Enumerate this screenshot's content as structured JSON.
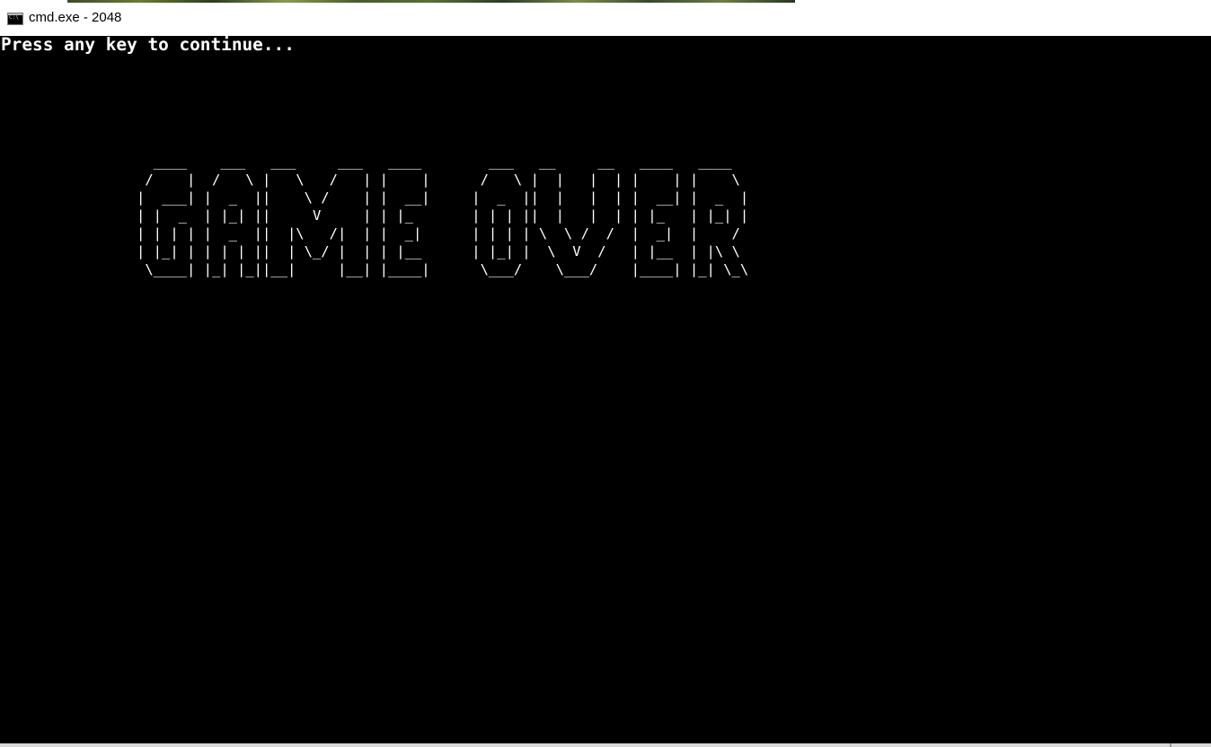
{
  "window": {
    "title": "cmd.exe - 2048",
    "icon": "console-app-icon"
  },
  "console": {
    "prompt": "Press any key to continue...",
    "game_over_art": "  ____    ___   ___     ___   ____        ___   __     __   ____   ____\n /    |  /   \\ |   \\   /   | |    |      /   \\ |  |   |  | |    | |    \\\n|  ___| |  _  ||    \\ /    | |  __|     |  _  ||  |   |  | |  __| |  _  |\n| |  _  | |_| ||     V     | | |_       | | | ||  |   |  | | |_   | |_| |\n| | | | |  _  ||  |\\   /|  | |  _|      | | | | \\  \\ /  /  |  _|  |    /\n| |_| | | | | ||  | \\_/ |  | | |__      | |_| |  \\  V  /   | |__  | |\\ \\\n \\____| |_| |_||__|     |__| |____|      \\___/    \\___/    |____| |_| \\_\\",
    "text_color": "#ffffff",
    "background_color": "#000000"
  }
}
